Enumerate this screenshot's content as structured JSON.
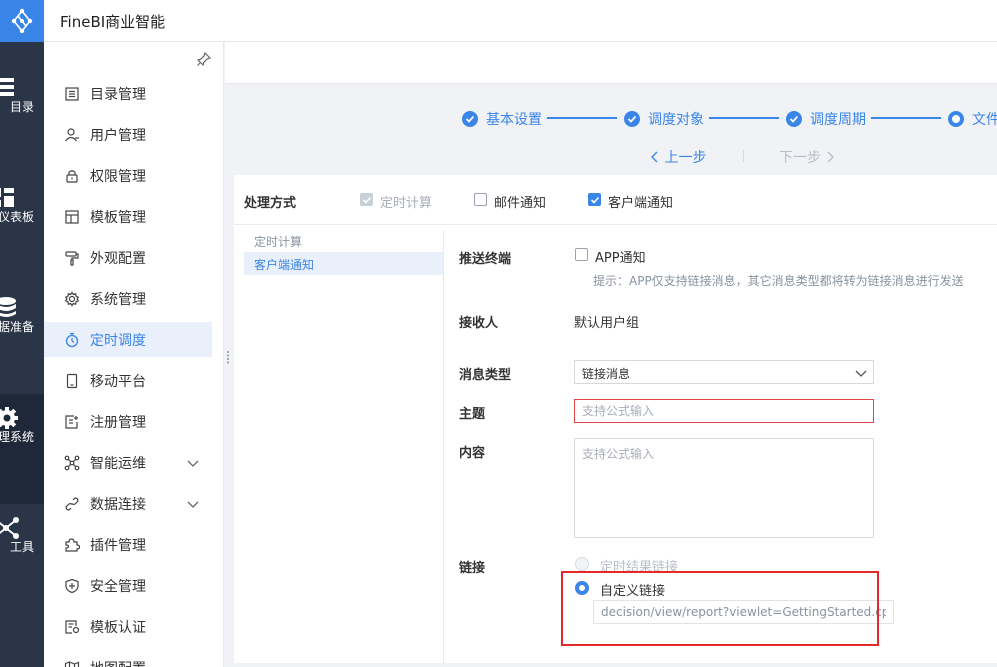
{
  "app": {
    "title": "FineBI商业智能"
  },
  "rail": {
    "items": [
      {
        "label": "目录",
        "icon": "list-icon"
      },
      {
        "label": "仪表板",
        "icon": "dashboard-icon"
      },
      {
        "label": "数据准备",
        "icon": "database-icon"
      },
      {
        "label": "管理系统",
        "icon": "gear-icon",
        "active": true
      },
      {
        "label": "工具",
        "icon": "network-icon"
      }
    ]
  },
  "menu": {
    "items": [
      {
        "label": "目录管理",
        "icon": "catalog-icon"
      },
      {
        "label": "用户管理",
        "icon": "user-icon"
      },
      {
        "label": "权限管理",
        "icon": "lock-icon"
      },
      {
        "label": "模板管理",
        "icon": "template-icon"
      },
      {
        "label": "外观配置",
        "icon": "paint-roller-icon"
      },
      {
        "label": "系统管理",
        "icon": "gear-icon"
      },
      {
        "label": "定时调度",
        "icon": "stopwatch-icon",
        "active": true
      },
      {
        "label": "移动平台",
        "icon": "mobile-icon"
      },
      {
        "label": "注册管理",
        "icon": "register-icon"
      },
      {
        "label": "智能运维",
        "icon": "nodes-icon",
        "expandable": true
      },
      {
        "label": "数据连接",
        "icon": "link-icon",
        "expandable": true
      },
      {
        "label": "插件管理",
        "icon": "puzzle-icon"
      },
      {
        "label": "安全管理",
        "icon": "shield-icon"
      },
      {
        "label": "模板认证",
        "icon": "certificate-icon"
      },
      {
        "label": "地图配置",
        "icon": "map-icon"
      }
    ]
  },
  "wizard": {
    "steps": [
      {
        "label": "基本设置",
        "state": "done"
      },
      {
        "label": "调度对象",
        "state": "done"
      },
      {
        "label": "调度周期",
        "state": "done"
      },
      {
        "label": "文件处理",
        "state": "current"
      }
    ],
    "prev_label": "上一步",
    "next_label": "下一步"
  },
  "method": {
    "title": "处理方式",
    "options": [
      {
        "label": "定时计算",
        "checked": true,
        "disabled": true
      },
      {
        "label": "邮件通知",
        "checked": false
      },
      {
        "label": "客户端通知",
        "checked": true
      }
    ]
  },
  "subnav": {
    "title": "定时计算",
    "active_item": "客户端通知"
  },
  "form": {
    "terminal": {
      "label": "推送终端",
      "option": "APP通知",
      "checked": false,
      "hint": "提示：APP仅支持链接消息，其它消息类型都将转为链接消息进行发送"
    },
    "receiver": {
      "label": "接收人",
      "value": "默认用户组"
    },
    "message_type": {
      "label": "消息类型",
      "value": "链接消息"
    },
    "subject": {
      "label": "主题",
      "placeholder": "支持公式输入"
    },
    "content": {
      "label": "内容",
      "placeholder": "支持公式输入"
    },
    "link": {
      "label": "链接",
      "options": [
        {
          "label": "定时结果链接",
          "disabled": true
        },
        {
          "label": "自定义链接",
          "checked": true
        }
      ],
      "custom_value": "decision/view/report?viewlet=GettingStarted.cpt"
    }
  },
  "colors": {
    "accent": "#3a85e8",
    "rail": "#2b3548",
    "highlight": "#e4292b"
  }
}
